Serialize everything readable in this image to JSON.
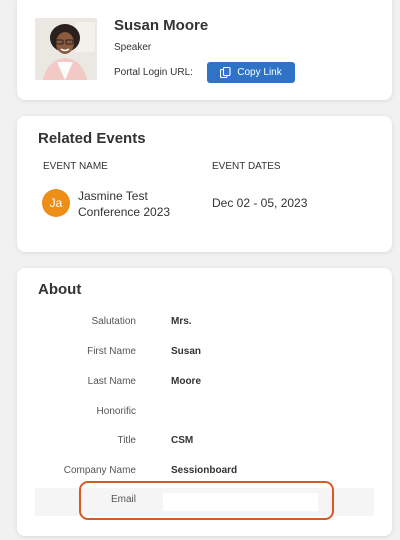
{
  "profile": {
    "name": "Susan Moore",
    "role": "Speaker",
    "portal_label": "Portal Login URL:",
    "copy_button": "Copy Link"
  },
  "related_events": {
    "title": "Related Events",
    "columns": [
      "EVENT NAME",
      "EVENT DATES"
    ],
    "rows": [
      {
        "initials": "Ja",
        "name": "Jasmine Test Conference 2023",
        "dates": "Dec 02 - 05, 2023"
      }
    ]
  },
  "about": {
    "title": "About",
    "fields": [
      {
        "label": "Salutation",
        "value": "Mrs."
      },
      {
        "label": "First Name",
        "value": "Susan"
      },
      {
        "label": "Last Name",
        "value": "Moore"
      },
      {
        "label": "Honorific",
        "value": ""
      },
      {
        "label": "Title",
        "value": "CSM"
      },
      {
        "label": "Company Name",
        "value": "Sessionboard"
      },
      {
        "label": "Email",
        "value": ""
      }
    ]
  },
  "colors": {
    "accent": "#2f73c7",
    "event_badge": "#ee8e16",
    "highlight": "#d55a25"
  },
  "icons": {
    "copy": "copy-icon"
  }
}
